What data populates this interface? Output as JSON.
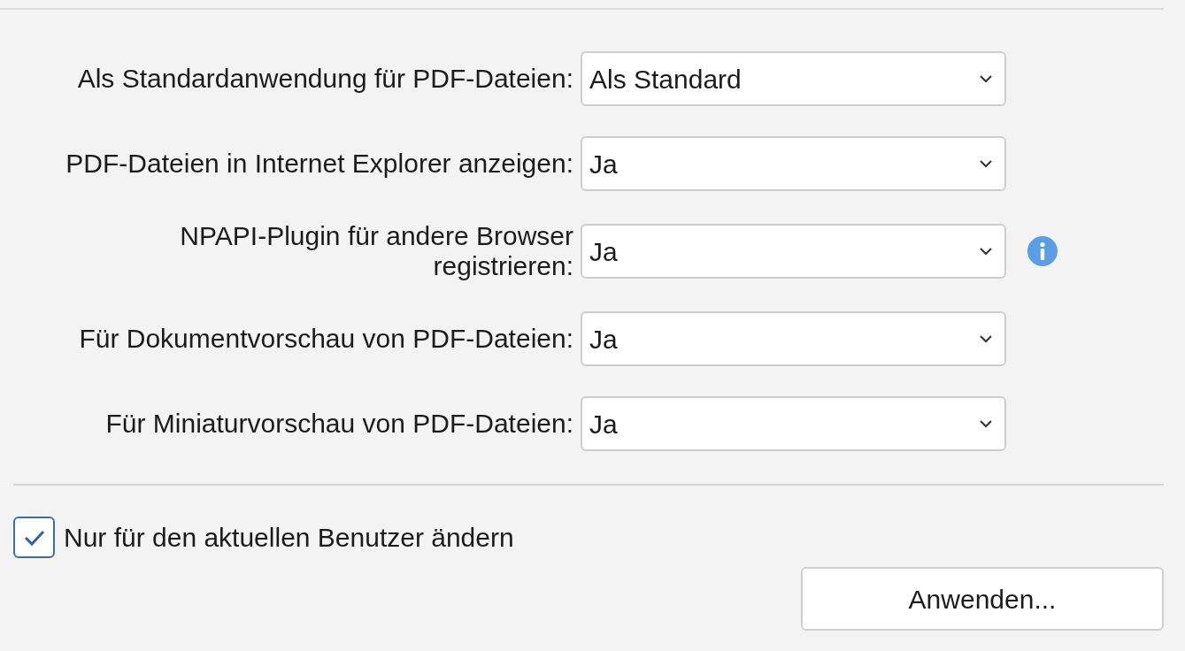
{
  "settings": [
    {
      "label": "Als Standardanwendung für PDF-Dateien:",
      "value": "Als Standard",
      "info": false
    },
    {
      "label": "PDF-Dateien in Internet Explorer anzeigen:",
      "value": "Ja",
      "info": false
    },
    {
      "label": "NPAPI-Plugin für andere Browser registrieren:",
      "value": "Ja",
      "info": true
    },
    {
      "label": "Für Dokumentvorschau von PDF-Dateien:",
      "value": "Ja",
      "info": false
    },
    {
      "label": "Für Miniaturvorschau von PDF-Dateien:",
      "value": "Ja",
      "info": false
    }
  ],
  "current_user_only": {
    "label": "Nur für den aktuellen Benutzer ändern",
    "checked": true
  },
  "apply_button": "Anwenden..."
}
